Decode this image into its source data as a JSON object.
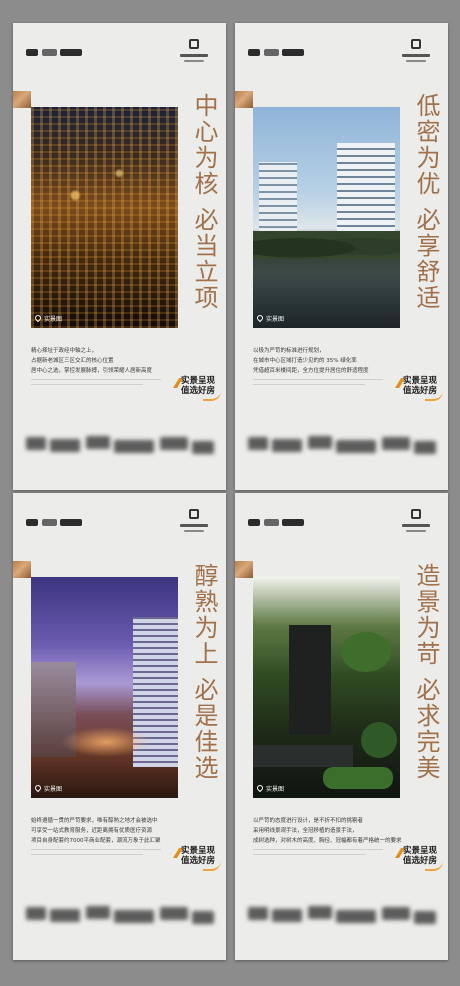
{
  "cards": [
    {
      "title_top": "中心为核",
      "title_bottom": "必当立项",
      "location": "实景图",
      "body": [
        "精心择址于政经中轴之上，",
        "占据新老城区三区交汇的核心位置",
        "居中心之选，掌控发展脉搏，引领荣耀人居新高度"
      ],
      "badge_line1": "实景呈现",
      "badge_line2": "值选好房"
    },
    {
      "title_top": "低密为优",
      "title_bottom": "必享舒适",
      "location": "实景图",
      "body": [
        "以极为严苛的标准进行规划，",
        "在城市中心区域打造少见的的 35% 绿化率",
        "凭借超百米楼间距，全方位提升居住的舒适程度"
      ],
      "badge_line1": "实景呈现",
      "badge_line2": "值选好房"
    },
    {
      "title_top": "醇熟为上",
      "title_bottom": "必是佳选",
      "location": "实景图",
      "body": [
        "始终遵循一贯的严苛要求，唯有醇熟之地才会被选中",
        "可享受一站式教育服务，近距离拥有优质医疗资源",
        "项目自身配套约7000平商业配套，潮流万象于此汇聚"
      ],
      "badge_line1": "实景呈现",
      "badge_line2": "值选好房"
    },
    {
      "title_top": "造景为苛",
      "title_bottom": "必求完美",
      "location": "实景图",
      "body": [
        "以严苛的态度进行设计，是不折不扣的挑剔者",
        "采用明线景观手法，全冠移植的造景手法，",
        "成树选种，对树木的高度、胸径、冠幅都有着严格统一的要求"
      ],
      "badge_line1": "实景呈现",
      "badge_line2": "值选好房"
    }
  ]
}
